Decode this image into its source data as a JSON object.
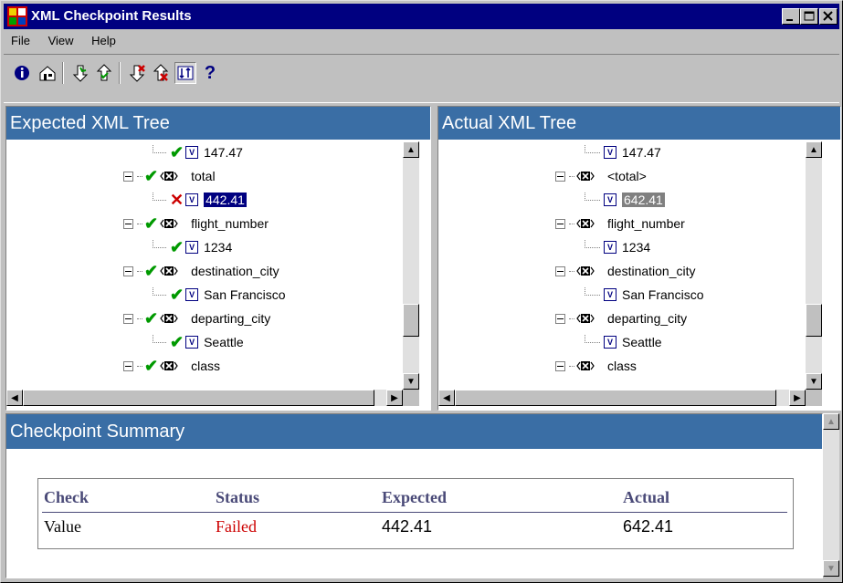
{
  "window": {
    "title": "XML Checkpoint Results"
  },
  "menu": [
    {
      "label": "File",
      "key": "F"
    },
    {
      "label": "View",
      "key": "V"
    },
    {
      "label": "Help",
      "key": "H"
    }
  ],
  "toolbar": [
    {
      "icon": "info-icon",
      "pressed": false
    },
    {
      "icon": "properties-icon",
      "pressed": false
    },
    {
      "icon": "next-check-icon",
      "pressed": false
    },
    {
      "icon": "previous-check-icon",
      "pressed": false
    },
    {
      "icon": "next-failed-check-icon",
      "pressed": false
    },
    {
      "icon": "previous-failed-check-icon",
      "pressed": false
    },
    {
      "icon": "synchronize-scroll-icon",
      "pressed": true
    },
    {
      "icon": "help-icon",
      "pressed": false
    }
  ],
  "expected": {
    "title": "Expected XML Tree",
    "nodes": [
      {
        "kind": "value",
        "text": "147.47",
        "status": "pass"
      },
      {
        "kind": "element",
        "text": "total",
        "status": "pass"
      },
      {
        "kind": "value",
        "text": "442.41",
        "status": "fail",
        "selected": true
      },
      {
        "kind": "element",
        "text": "flight_number",
        "status": "pass"
      },
      {
        "kind": "value",
        "text": "1234",
        "status": "pass"
      },
      {
        "kind": "element",
        "text": "destination_city",
        "status": "pass"
      },
      {
        "kind": "value",
        "text": "San Francisco",
        "status": "pass"
      },
      {
        "kind": "element",
        "text": "departing_city",
        "status": "pass"
      },
      {
        "kind": "value",
        "text": "Seattle",
        "status": "pass"
      },
      {
        "kind": "element",
        "text": "class",
        "status": "pass"
      }
    ]
  },
  "actual": {
    "title": "Actual XML Tree",
    "nodes": [
      {
        "kind": "value",
        "text": "147.47"
      },
      {
        "kind": "element",
        "text": "<total>"
      },
      {
        "kind": "value",
        "text": "642.41",
        "selected": true
      },
      {
        "kind": "element",
        "text": "flight_number"
      },
      {
        "kind": "value",
        "text": "1234"
      },
      {
        "kind": "element",
        "text": "destination_city"
      },
      {
        "kind": "value",
        "text": "San Francisco"
      },
      {
        "kind": "element",
        "text": "departing_city"
      },
      {
        "kind": "value",
        "text": "Seattle"
      },
      {
        "kind": "element",
        "text": "class"
      }
    ]
  },
  "summary": {
    "title": "Checkpoint Summary",
    "headers": {
      "check": "Check",
      "status": "Status",
      "expected": "Expected",
      "actual": "Actual"
    },
    "row": {
      "check": "Value",
      "status": "Failed",
      "expected": "442.41",
      "actual": "642.41"
    },
    "colors": {
      "failed": "#cc0000",
      "header": "#3a6ea5"
    }
  }
}
